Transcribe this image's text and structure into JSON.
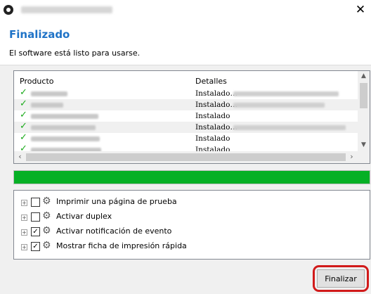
{
  "window": {
    "close_glyph": "✕"
  },
  "header": {
    "title": "Finalizado",
    "subtitle": "El software está listo para usarse.",
    "accent_color": "#1f73c7"
  },
  "products": {
    "columns": [
      "Producto",
      "Detalles"
    ],
    "rows": [
      {
        "status": "installed",
        "detail": "Instalado…",
        "detail_blurred": true
      },
      {
        "status": "installed",
        "detail": "Instalado…",
        "detail_blurred": true
      },
      {
        "status": "installed",
        "detail": "Instalado",
        "detail_blurred": false
      },
      {
        "status": "installed",
        "detail": "Instalado…",
        "detail_blurred": true
      },
      {
        "status": "installed",
        "detail": "Instalado",
        "detail_blurred": false
      },
      {
        "status": "installed",
        "detail": "Instalado",
        "detail_blurred": false
      }
    ],
    "check_glyph": "✓",
    "check_color": "#1cab1c"
  },
  "progress": {
    "fraction": 1.0,
    "color": "#06b025"
  },
  "options": [
    {
      "label": "Imprimir una página de prueba",
      "checked": false
    },
    {
      "label": "Activar duplex",
      "checked": false
    },
    {
      "label": "Activar notificación de evento",
      "checked": true
    },
    {
      "label": "Mostrar ficha de impresión rápida",
      "checked": true
    }
  ],
  "footer": {
    "finish_label": "Finalizar",
    "highlight_color": "#d11a1a"
  }
}
